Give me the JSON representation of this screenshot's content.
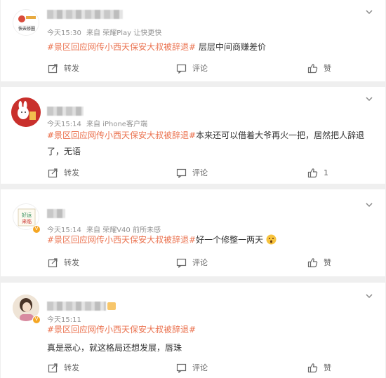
{
  "posts": [
    {
      "meta": [
        "今天15:30",
        "来自 荣耀Play 让快更快"
      ],
      "tag": "#景区回应网传小西天保安大叔被辞退#",
      "text": " 层层中间商赚差价",
      "avatar_label": "快去修圈",
      "actions": {
        "share": "转发",
        "comment": "评论",
        "like": "赞"
      }
    },
    {
      "meta": [
        "今天15:14",
        "来自 iPhone客户端"
      ],
      "tag": "#景区回应网传小西天保安大叔被辞退#",
      "text": "本来还可以借着大爷再火一把，居然把人辞退了，无语",
      "actions": {
        "share": "转发",
        "comment": "评论",
        "like": "1"
      }
    },
    {
      "meta": [
        "今天15:14",
        "来自 荣耀V40 前所未感"
      ],
      "tag": "#景区回应网传小西天保安大叔被辞退#",
      "text": "好一个修整一两天",
      "avatar_label": "好运来临",
      "actions": {
        "share": "转发",
        "comment": "评论",
        "like": "赞"
      }
    },
    {
      "meta": [
        "今天15:11"
      ],
      "tag": "#景区回应网传小西天保安大叔被辞退#",
      "text": "真是恶心，就这格局还想发展，唇珠",
      "actions": {
        "share": "转发",
        "comment": "评论",
        "like": "赞"
      }
    }
  ],
  "colors": {
    "tag": "#eb7350",
    "meta": "#939393",
    "badge": "#f5a623"
  }
}
